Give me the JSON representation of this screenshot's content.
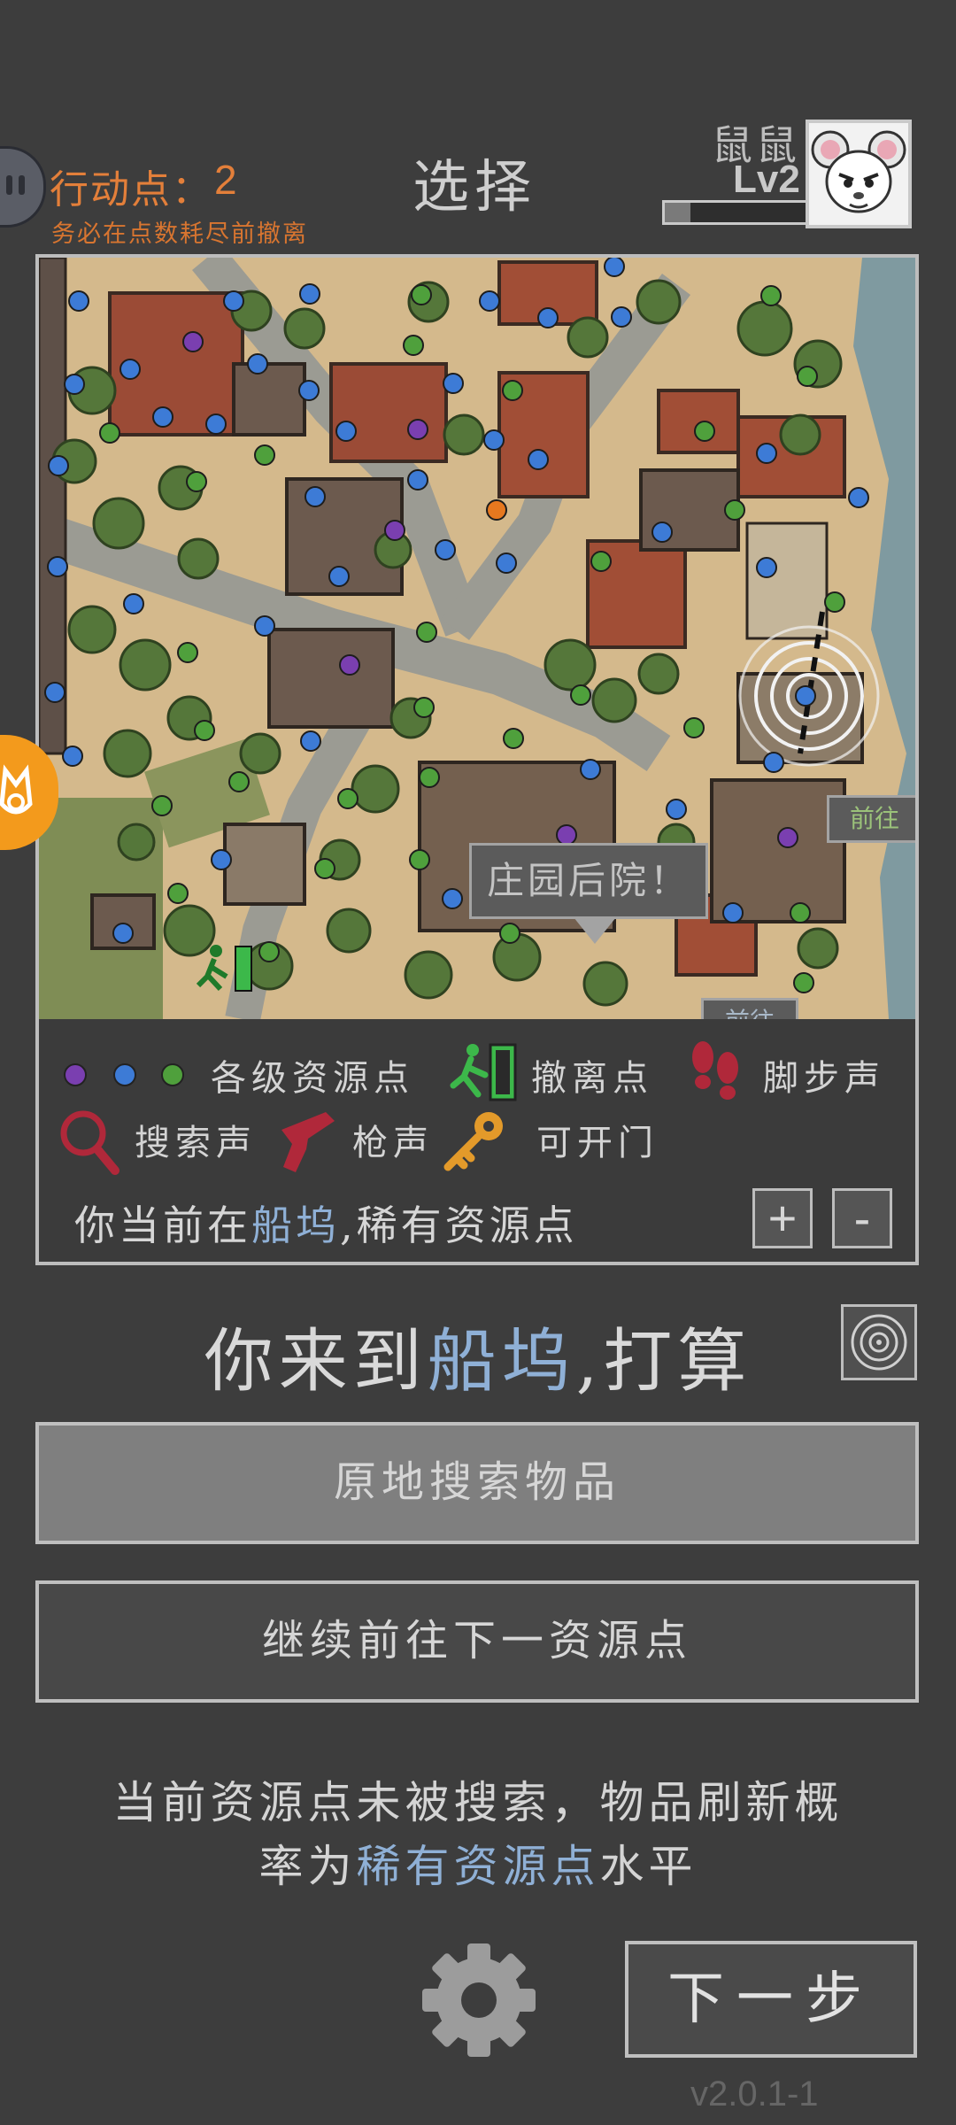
{
  "header": {
    "action_points_label": "行动点：",
    "action_points_value": "2",
    "action_points_warning": "务必在点数耗尽前撤离",
    "title": "选择",
    "character_name": "鼠鼠",
    "character_level": "Lv2",
    "xp_progress": 0.18
  },
  "map": {
    "label_courtyard": "庄园后院！",
    "label_go_1": "前往",
    "label_go_2": "前往"
  },
  "legend": {
    "resource_points": "各级资源点",
    "evacuation_point": "撤离点",
    "footsteps": "脚步声",
    "search_sound": "搜索声",
    "gunshot": "枪声",
    "openable_door": "可开门",
    "dot_colors": [
      "#7a3fb0",
      "#3d7bd6",
      "#4fa03c"
    ],
    "icons": [
      "purple-dot-icon",
      "blue-dot-icon",
      "green-dot-icon",
      "evacuation-exit-icon",
      "footprints-icon",
      "magnifier-icon",
      "pistol-icon",
      "key-icon"
    ]
  },
  "location": {
    "prefix": "你当前在",
    "place": "船坞",
    "suffix": ",稀有资源点"
  },
  "zoom": {
    "plus": "+",
    "minus": "-"
  },
  "arrival": {
    "prefix": "你来到",
    "place": "船坞",
    "suffix": ",打算"
  },
  "actions": {
    "search_here": "原地搜索物品",
    "go_next_resource": "继续前往下一资源点"
  },
  "status": {
    "line1": "当前资源点未被搜索，物品刷新概",
    "line2_prefix": "率为",
    "line2_highlight": "稀有资源点",
    "line2_suffix": "水平"
  },
  "footer": {
    "next_step": "下一步",
    "version": "v2.0.1-1"
  },
  "colors": {
    "background": "#3d3d3d",
    "accent_orange": "#e37f3a",
    "highlight_blue": "#8fb0d6",
    "fab_orange": "#f39a1c"
  }
}
